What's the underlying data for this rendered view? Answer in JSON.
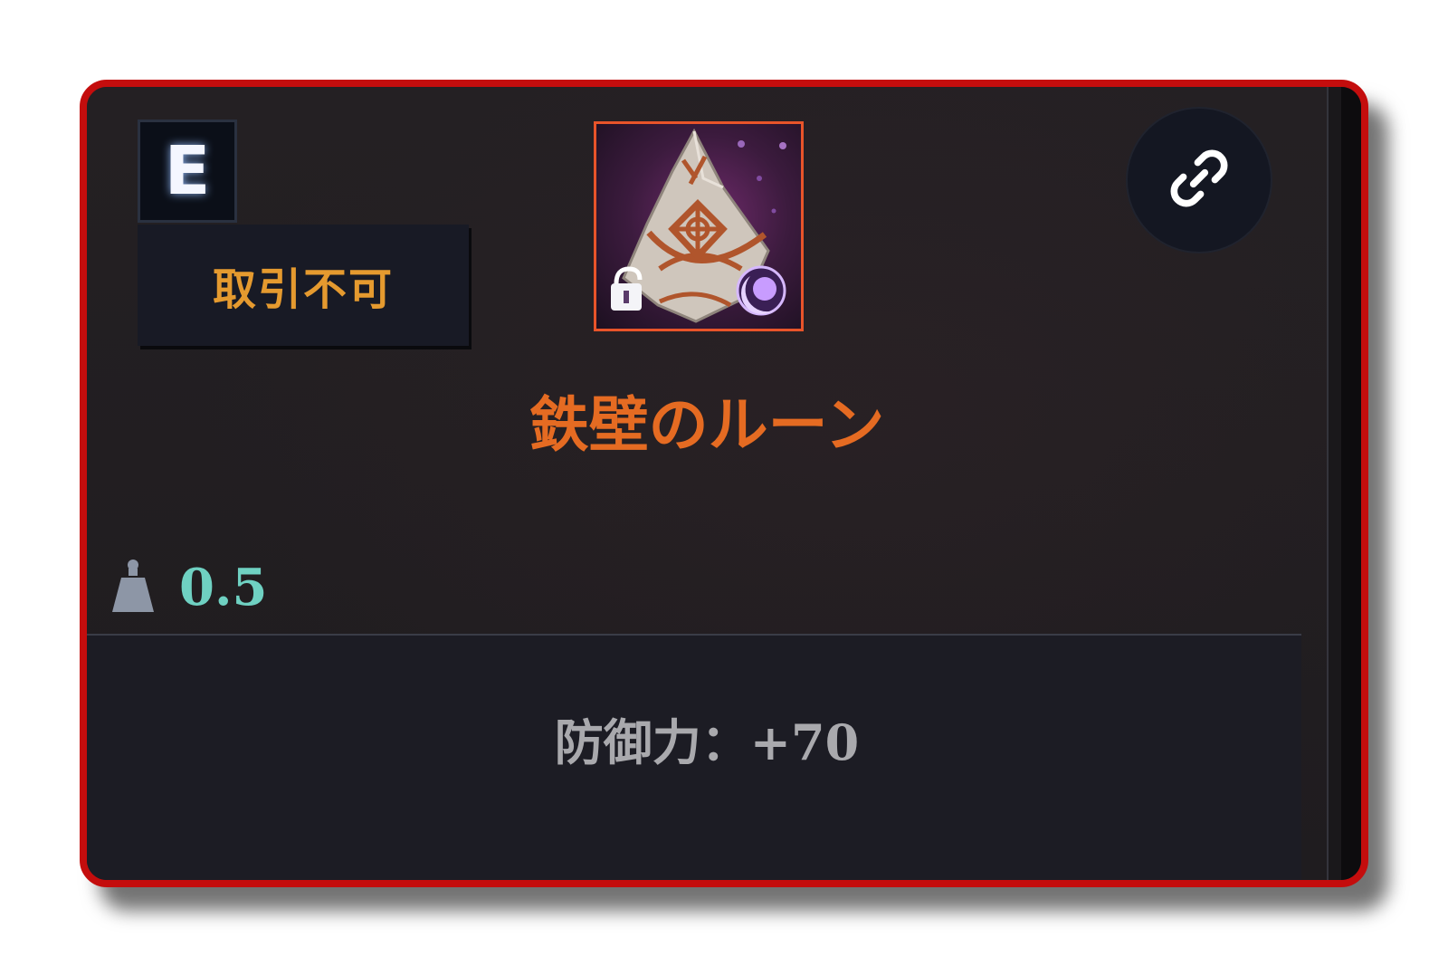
{
  "item": {
    "grade": "E",
    "trade_status": "取引不可",
    "name": "鉄壁のルーン",
    "weight": "0.5",
    "stat": "防御力：+70",
    "icon": "rune-icon",
    "lock_icon": "unlocked-padlock-icon",
    "element_icon": "moon-icon"
  },
  "actions": {
    "link_icon": "link-icon"
  },
  "colors": {
    "frame_border": "#c40d0d",
    "item_name": "#e56b22",
    "trade_status": "#e59a2f",
    "weight_value": "#6fd1c2",
    "stat_text": "#a9a9ad",
    "icon_border": "#e8542a"
  }
}
